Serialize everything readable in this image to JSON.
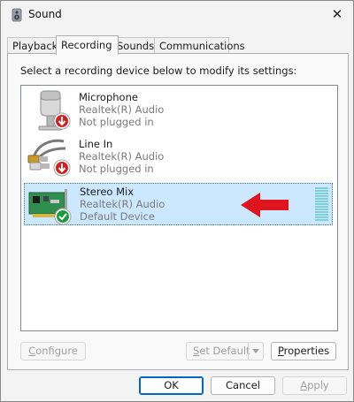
{
  "window": {
    "title": "Sound",
    "close_glyph": "✕"
  },
  "tabs": [
    {
      "label": "Playback"
    },
    {
      "label": "Recording"
    },
    {
      "label": "Sounds"
    },
    {
      "label": "Communications"
    }
  ],
  "active_tab": "Recording",
  "instructions": "Select a recording device below to modify its settings:",
  "devices": [
    {
      "name": "Microphone",
      "driver": "Realtek(R) Audio",
      "status": "Not plugged in",
      "icon": "microphone-icon",
      "badge": "down-arrow-badge"
    },
    {
      "name": "Line In",
      "driver": "Realtek(R) Audio",
      "status": "Not plugged in",
      "icon": "line-in-cable-icon",
      "badge": "down-arrow-badge"
    },
    {
      "name": "Stereo Mix",
      "driver": "Realtek(R) Audio",
      "status": "Default Device",
      "icon": "sound-card-icon",
      "badge": "checkmark-badge",
      "selected": true
    }
  ],
  "buttons": {
    "configure_pre": "",
    "configure_key": "C",
    "configure_post": "onfigure",
    "set_default_pre": "",
    "set_default_key": "S",
    "set_default_post": "et Default",
    "properties_pre": "",
    "properties_key": "P",
    "properties_post": "roperties",
    "ok": "OK",
    "cancel": "Cancel",
    "apply_pre": "",
    "apply_key": "A",
    "apply_post": "pply"
  },
  "colors": {
    "selection": "#cce8ff",
    "arrow": "#e0141e",
    "check_badge": "#1a9b3c",
    "down_badge": "#d41f1f",
    "level_meter": "#7fd0d6"
  }
}
